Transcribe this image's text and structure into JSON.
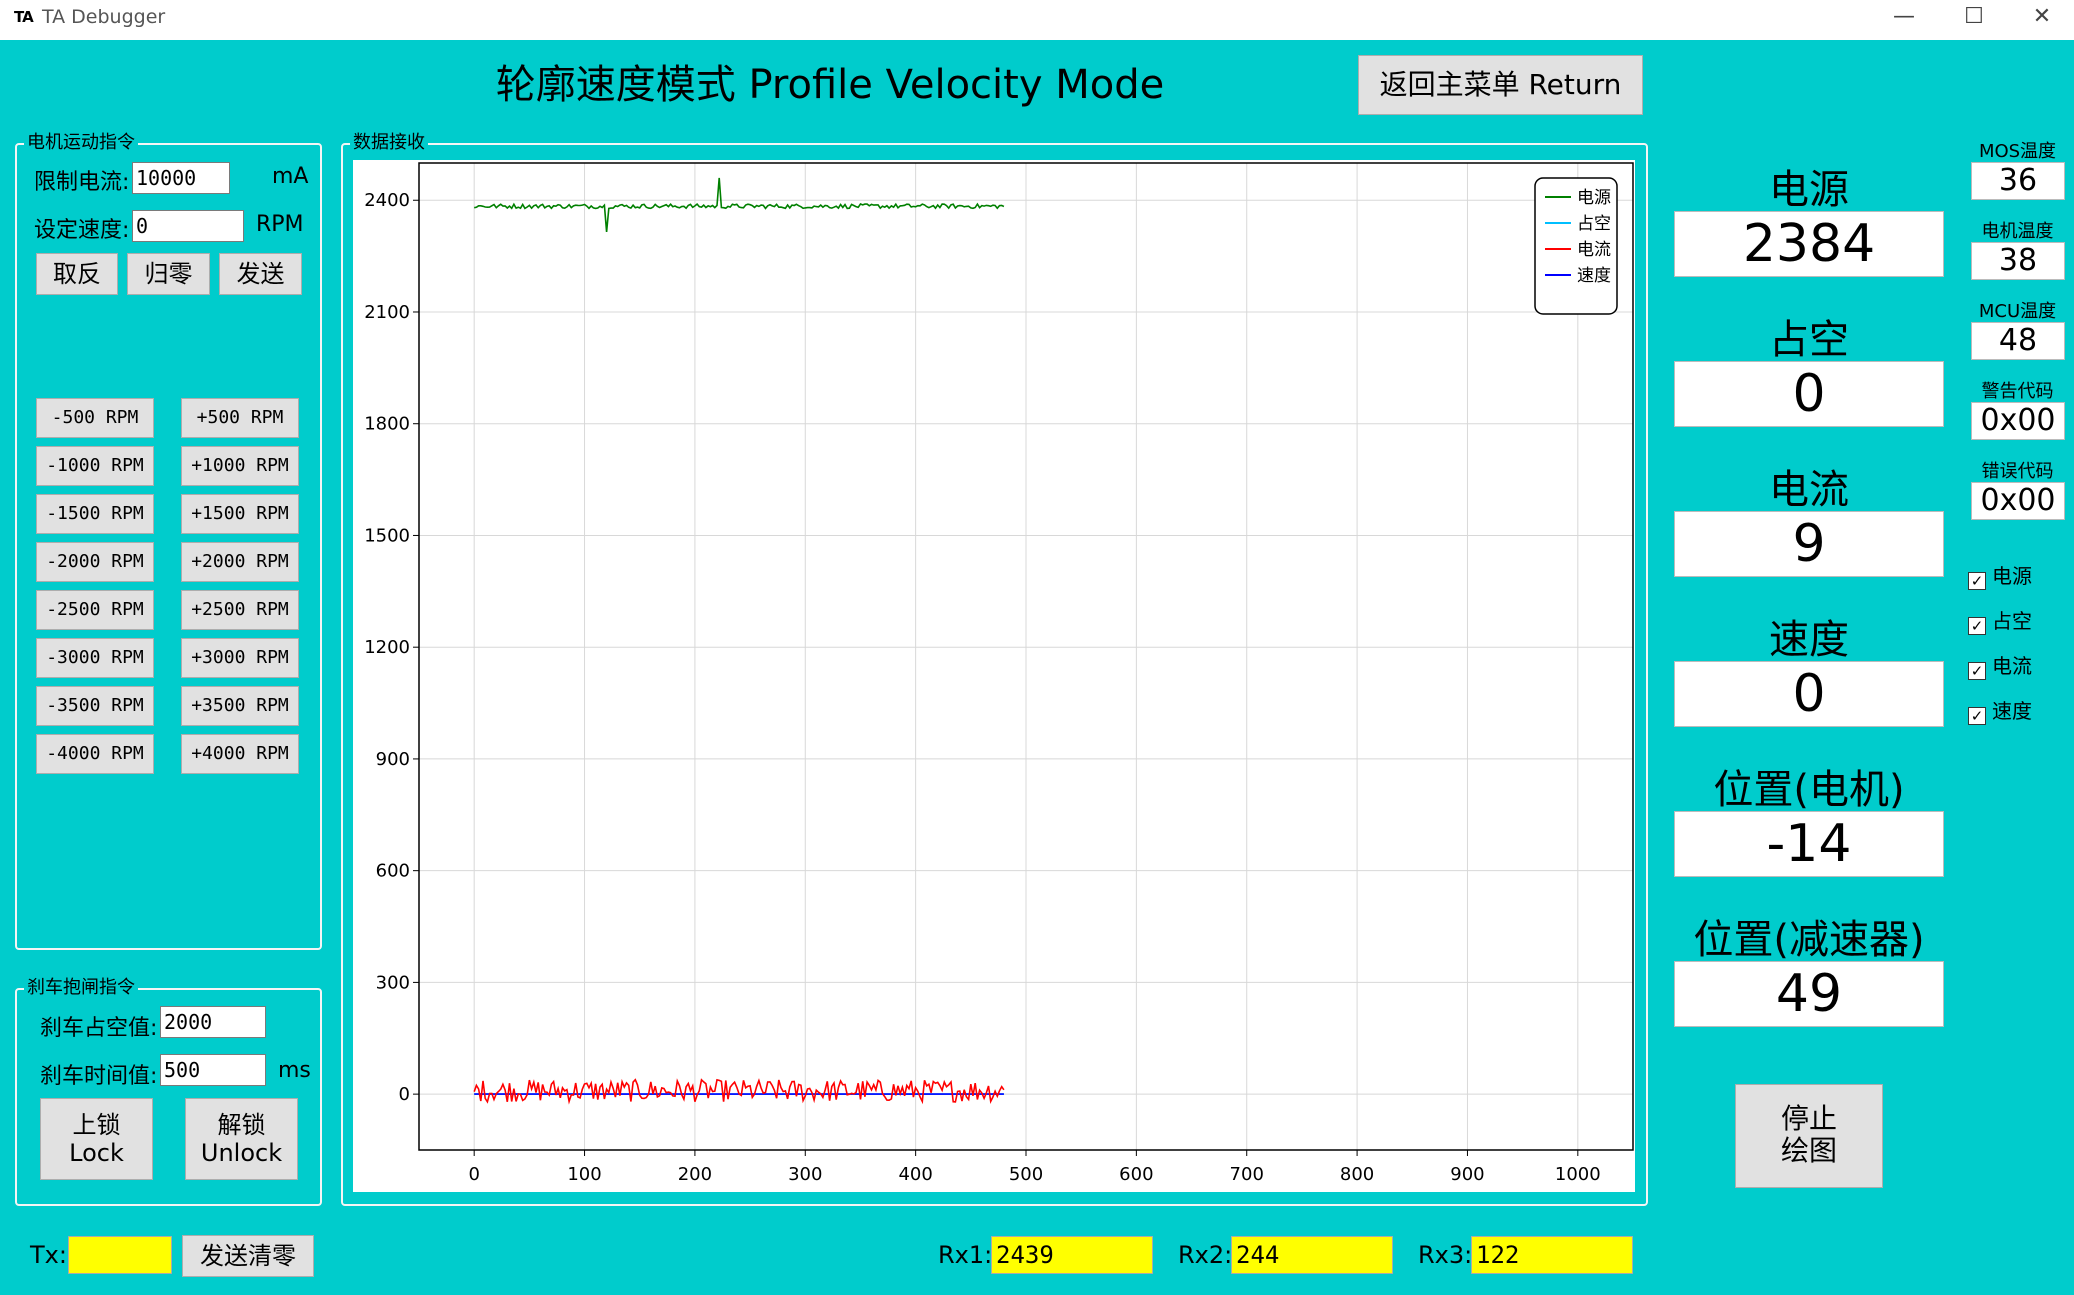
{
  "window": {
    "logo": "TA",
    "title": "TA Debugger",
    "minimize": "—",
    "maximize": "☐",
    "close": "✕"
  },
  "page_title": "轮廓速度模式 Profile Velocity Mode",
  "return_button": "返回主菜单 Return",
  "motion": {
    "group_label": "电机运动指令",
    "current_limit_label": "限制电流:",
    "current_limit_value": "10000",
    "current_unit": "mA",
    "speed_label": "设定速度:",
    "speed_value": "0",
    "speed_unit": "RPM",
    "invert_button": "取反",
    "zero_button": "归零",
    "send_button": "发送",
    "rpm_neg": [
      "-500 RPM",
      "-1000 RPM",
      "-1500 RPM",
      "-2000 RPM",
      "-2500 RPM",
      "-3000 RPM",
      "-3500 RPM",
      "-4000 RPM"
    ],
    "rpm_pos": [
      "+500 RPM",
      "+1000 RPM",
      "+1500 RPM",
      "+2000 RPM",
      "+2500 RPM",
      "+3000 RPM",
      "+3500 RPM",
      "+4000 RPM"
    ]
  },
  "brake": {
    "group_label": "刹车抱闸指令",
    "duty_label": "刹车占空值:",
    "duty_value": "2000",
    "time_label": "刹车时间值:",
    "time_value": "500",
    "time_unit": "ms",
    "lock_button": [
      "上锁",
      "Lock"
    ],
    "unlock_button": [
      "解锁",
      "Unlock"
    ]
  },
  "data_group_label": "数据接收",
  "chart_data": {
    "type": "line",
    "xlim": [
      -50,
      1050
    ],
    "ylim": [
      -150,
      2500
    ],
    "x_ticks": [
      0,
      100,
      200,
      300,
      400,
      500,
      600,
      700,
      800,
      900,
      1000
    ],
    "y_ticks": [
      0,
      300,
      600,
      900,
      1200,
      1500,
      1800,
      2100,
      2400
    ],
    "grid": true,
    "legend_position": "top-right",
    "series": [
      {
        "name": "电源",
        "color": "#008000",
        "x_range": [
          0,
          480
        ],
        "base": 2384,
        "noise": 6,
        "spikes": [
          {
            "x": 5,
            "y": 2345
          },
          {
            "x": 120,
            "y": 2315
          },
          {
            "x": 222,
            "y": 2460
          },
          {
            "x": 315,
            "y": 2350
          },
          {
            "x": 355,
            "y": 2440
          }
        ]
      },
      {
        "name": "占空",
        "color": "#00BFFF",
        "x_range": [
          0,
          480
        ],
        "base": 0,
        "noise": 0,
        "spikes": []
      },
      {
        "name": "电流",
        "color": "#FF0000",
        "x_range": [
          0,
          480
        ],
        "base": 9,
        "noise": 30,
        "spikes": []
      },
      {
        "name": "速度",
        "color": "#0000FF",
        "x_range": [
          0,
          480
        ],
        "base": 0,
        "noise": 0,
        "spikes": []
      }
    ]
  },
  "values": [
    {
      "label": "电源",
      "value": "2384"
    },
    {
      "label": "占空",
      "value": "0"
    },
    {
      "label": "电流",
      "value": "9"
    },
    {
      "label": "速度",
      "value": "0"
    },
    {
      "label": "位置(电机)",
      "value": "-14"
    },
    {
      "label": "位置(减速器)",
      "value": "49"
    }
  ],
  "small": [
    {
      "label": "MOS温度",
      "value": "36"
    },
    {
      "label": "电机温度",
      "value": "38"
    },
    {
      "label": "MCU温度",
      "value": "48"
    },
    {
      "label": "警告代码",
      "value": "0x00"
    },
    {
      "label": "错误代码",
      "value": "0x00"
    }
  ],
  "checkboxes": [
    {
      "label": "电源",
      "checked": true
    },
    {
      "label": "占空",
      "checked": true
    },
    {
      "label": "电流",
      "checked": true
    },
    {
      "label": "速度",
      "checked": true
    }
  ],
  "stop_button": [
    "停止",
    "绘图"
  ],
  "tx_label": "Tx:",
  "tx_value": "",
  "clear_button": "发送清零",
  "rx": [
    {
      "label": "Rx1:",
      "value": "2439"
    },
    {
      "label": "Rx2:",
      "value": "244"
    },
    {
      "label": "Rx3:",
      "value": "122"
    }
  ]
}
